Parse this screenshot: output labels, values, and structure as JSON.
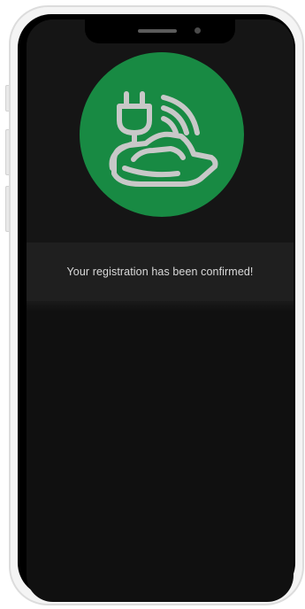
{
  "app": {
    "logo_icon": "ev-charger-plug-car-icon",
    "logo_color": "#188a43",
    "logo_stroke_color": "#c8c8c8"
  },
  "confirmation": {
    "message": "Your registration has been confirmed!"
  },
  "colors": {
    "screen_background": "#101010",
    "banner_background": "#1f1f1f",
    "text": "#d9d9d9"
  }
}
